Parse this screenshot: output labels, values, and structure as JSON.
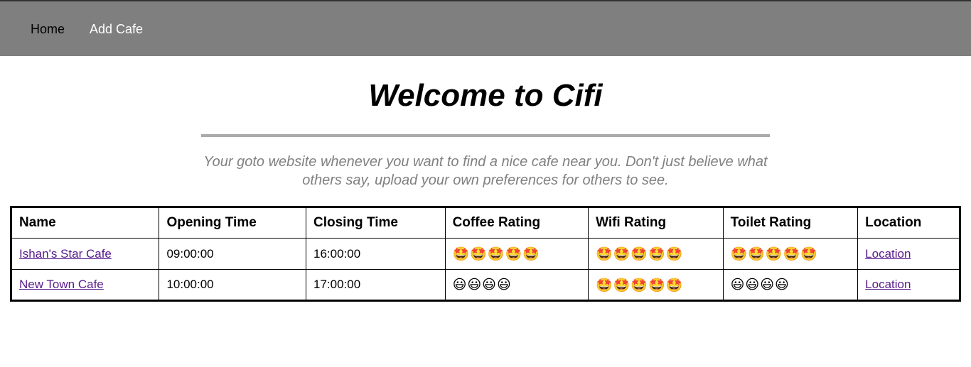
{
  "nav": {
    "home_label": "Home",
    "add_cafe_label": "Add Cafe"
  },
  "page": {
    "title": "Welcome to Cifi",
    "tagline": "Your goto website whenever you want to find a nice cafe near you. Don't just believe what others say, upload your own preferences for others to see."
  },
  "table": {
    "headers": [
      "Name",
      "Opening Time",
      "Closing Time",
      "Coffee Rating",
      "Wifi Rating",
      "Toilet Rating",
      "Location"
    ],
    "rows": [
      {
        "name": "Ishan's Star Cafe",
        "opening": "09:00:00",
        "closing": "16:00:00",
        "coffee": "🤩🤩🤩🤩🤩",
        "wifi": "🤩🤩🤩🤩🤩",
        "toilet": "🤩🤩🤩🤩🤩",
        "location": "Location"
      },
      {
        "name": "New Town Cafe",
        "opening": "10:00:00",
        "closing": "17:00:00",
        "coffee": "😃😃😃😃",
        "wifi": "🤩🤩🤩🤩🤩",
        "toilet": "😃😃😃😃",
        "location": "Location"
      }
    ]
  },
  "colors": {
    "navbar": "#7f7f7f",
    "link_visited": "#551a8b",
    "tagline": "#808080"
  }
}
